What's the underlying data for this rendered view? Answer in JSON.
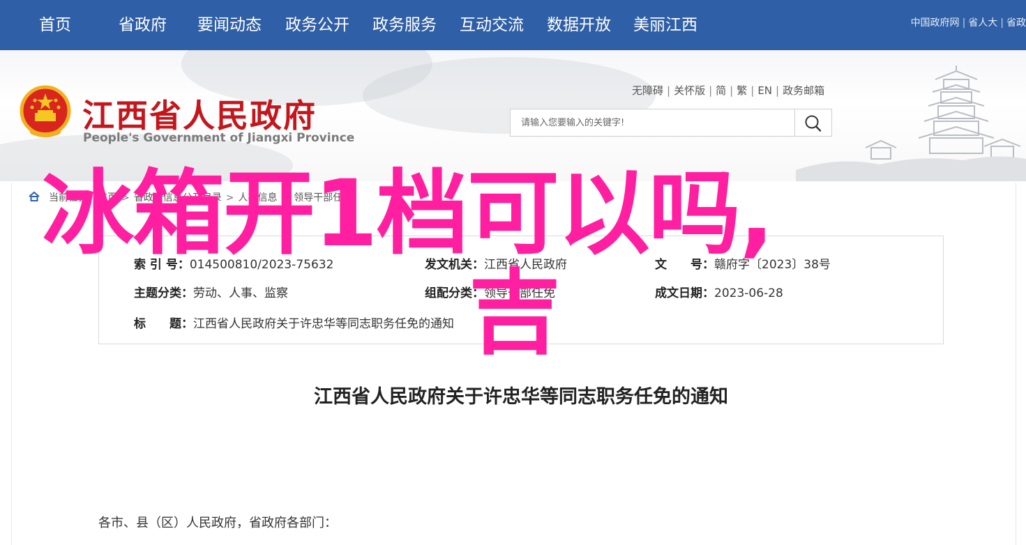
{
  "nav": {
    "items": [
      "首页",
      "省政府",
      "要闻动态",
      "政务公开",
      "政务服务",
      "互动交流",
      "数据开放",
      "美丽江西"
    ],
    "top_links": [
      "中国政府网",
      "省人大",
      "省政"
    ]
  },
  "header": {
    "title": "江西省人民政府",
    "subtitle": "People's Government of Jiangxi Province",
    "access_links": [
      "无障碍",
      "关怀版",
      "简",
      "繁",
      "EN",
      "政务邮箱"
    ],
    "search_placeholder": "请输入您要输入的关键字!"
  },
  "breadcrumb": {
    "prefix": "当前位置：",
    "items": [
      "首页",
      "省政府信息公开目录",
      "人事信息",
      "领导干部任免"
    ]
  },
  "info": {
    "index_label": "索 引 号：",
    "index_value": "014500810/2023-75632",
    "issuer_label": "发文机关：",
    "issuer_value": "江西省人民政府",
    "doc_no_label": "文　　号：",
    "doc_no_value": "赣府字〔2023〕38号",
    "topic_label": "主题分类：",
    "topic_value": "劳动、人事、监察",
    "org_label": "组配分类：",
    "org_value": "领导干部任免",
    "date_label": "成文日期：",
    "date_value": "2023-06-28",
    "title_label": "标　　题：",
    "title_value": "江西省人民政府关于许忠华等同志职务任免的通知"
  },
  "article": {
    "title": "江西省人民政府关于许忠华等同志职务任免的通知",
    "salutation": "各市、县（区）人民政府，省政府各部门："
  },
  "overlay": {
    "line1": "冰箱开1档可以吗,",
    "line2": "吉"
  },
  "colors": {
    "nav_bg": "#2f5fa6",
    "title_red": "#c4161c",
    "overlay_pink": "#ff1fa0"
  }
}
